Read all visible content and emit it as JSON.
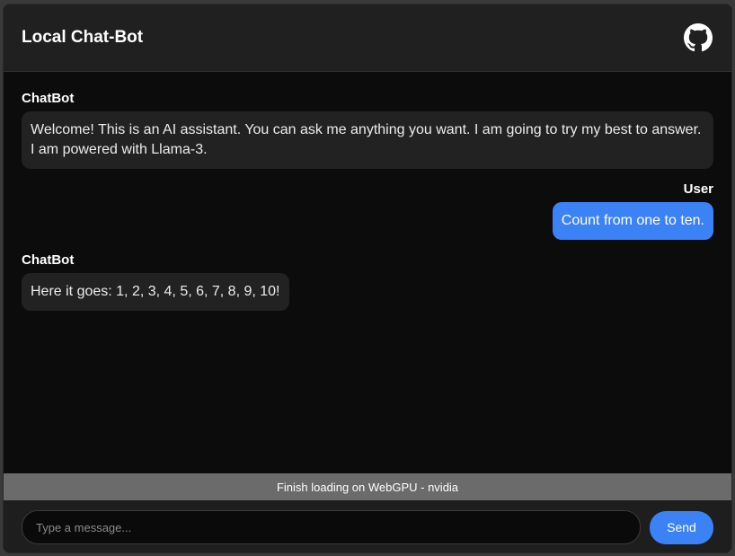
{
  "header": {
    "title": "Local Chat-Bot",
    "github_icon": "github-icon"
  },
  "messages": [
    {
      "role": "bot",
      "sender": "ChatBot",
      "text": "Welcome! This is an AI assistant. You can ask me anything you want. I am going to try my best to answer. I am powered with Llama-3."
    },
    {
      "role": "user",
      "sender": "User",
      "text": "Count from one to ten."
    },
    {
      "role": "bot",
      "sender": "ChatBot",
      "text": "Here it goes: 1, 2, 3, 4, 5, 6, 7, 8, 9, 10!"
    }
  ],
  "status": {
    "text": "Finish loading on WebGPU - nvidia"
  },
  "composer": {
    "placeholder": "Type a message...",
    "value": "",
    "send_label": "Send"
  },
  "colors": {
    "accent": "#3b82f6",
    "background": "#0c0c0c",
    "header": "#202020",
    "bot_bubble": "#222222",
    "status_bar": "#6b6b6b"
  }
}
